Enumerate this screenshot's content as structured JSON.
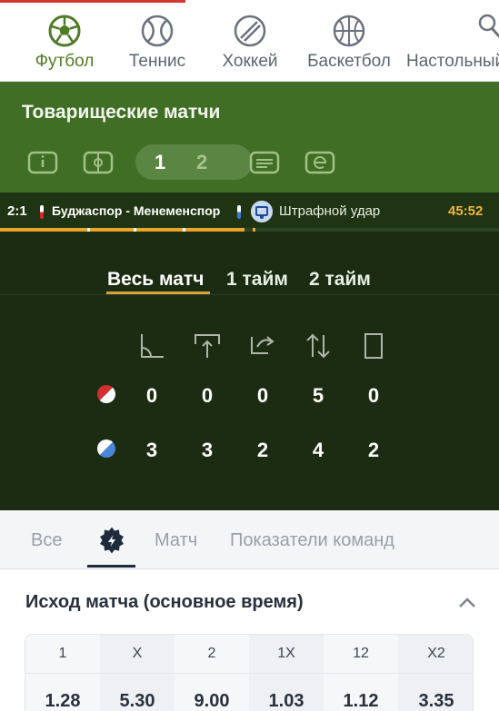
{
  "sports": [
    {
      "label": "Футбол",
      "icon": "soccer-ball-icon",
      "active": true
    },
    {
      "label": "Теннис",
      "icon": "tennis-ball-icon"
    },
    {
      "label": "Хоккей",
      "icon": "hockey-puck-icon"
    },
    {
      "label": "Баскетбол",
      "icon": "basketball-icon"
    },
    {
      "label": "Настольный",
      "icon": "table-tennis-icon"
    }
  ],
  "header": {
    "title": "Товарищеские матчи",
    "period_1": "1",
    "period_2": "2"
  },
  "ticker": {
    "score": "2:1",
    "teams": "Буджаспор - Менеменспор",
    "event": "Штрафной удар",
    "time": "45:52",
    "progress": 0.49
  },
  "stats": {
    "tabs": [
      "Весь матч",
      "1 тайм",
      "2 тайм"
    ],
    "active_tab": 0,
    "columns": [
      "corner-icon",
      "goal-kick-icon",
      "throw-in-icon",
      "substitution-icon",
      "card-icon"
    ],
    "team_a": [
      "0",
      "0",
      "0",
      "5",
      "0"
    ],
    "team_b": [
      "3",
      "3",
      "2",
      "4",
      "2"
    ]
  },
  "market_tabs": {
    "all": "Все",
    "match": "Матч",
    "team_stats": "Показатели команд"
  },
  "market": {
    "title": "Исход матча (основное время)",
    "odds": [
      {
        "label": "1",
        "value": "1.28"
      },
      {
        "label": "X",
        "value": "5.30"
      },
      {
        "label": "2",
        "value": "9.00"
      },
      {
        "label": "1X",
        "value": "1.03"
      },
      {
        "label": "12",
        "value": "1.12"
      },
      {
        "label": "X2",
        "value": "3.35"
      }
    ]
  },
  "colors": {
    "accent_green": "#3f6e24",
    "ticker_bg": "#1f3412",
    "stats_bg": "#1b2c13",
    "timer": "#f0b43d",
    "underline": "#d8a239"
  }
}
